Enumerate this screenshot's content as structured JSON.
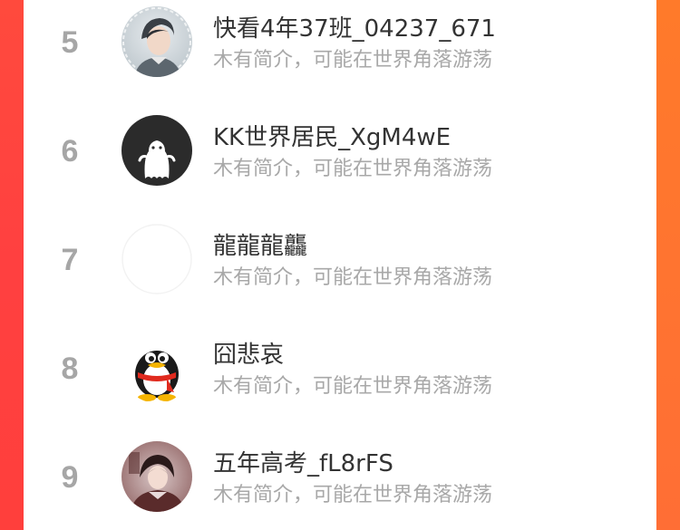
{
  "colors": {
    "left_gradient": "#ff4040",
    "right_gradient": "#ff7430",
    "rank_text": "#a6a6a6",
    "name_text": "#333333",
    "bio_text": "#a8a8a8"
  },
  "list": {
    "rows": [
      {
        "rank": "5",
        "name": "快看4年37班_04237_671",
        "bio": "木有简介，可能在世界角落游荡",
        "avatar": "photo-avatar"
      },
      {
        "rank": "6",
        "name": "KK世界居民_XgM4wE",
        "bio": "木有简介，可能在世界角落游荡",
        "avatar": "ghost-avatar"
      },
      {
        "rank": "7",
        "name": "龍龍龍龘",
        "bio": "木有简介，可能在世界角落游荡",
        "avatar": "blank-avatar"
      },
      {
        "rank": "8",
        "name": "囧悲哀",
        "bio": "木有简介，可能在世界角落游荡",
        "avatar": "penguin-avatar"
      },
      {
        "rank": "9",
        "name": "五年高考_fL8rFS",
        "bio": "木有简介，可能在世界角落游荡",
        "avatar": "anime-avatar"
      }
    ]
  }
}
